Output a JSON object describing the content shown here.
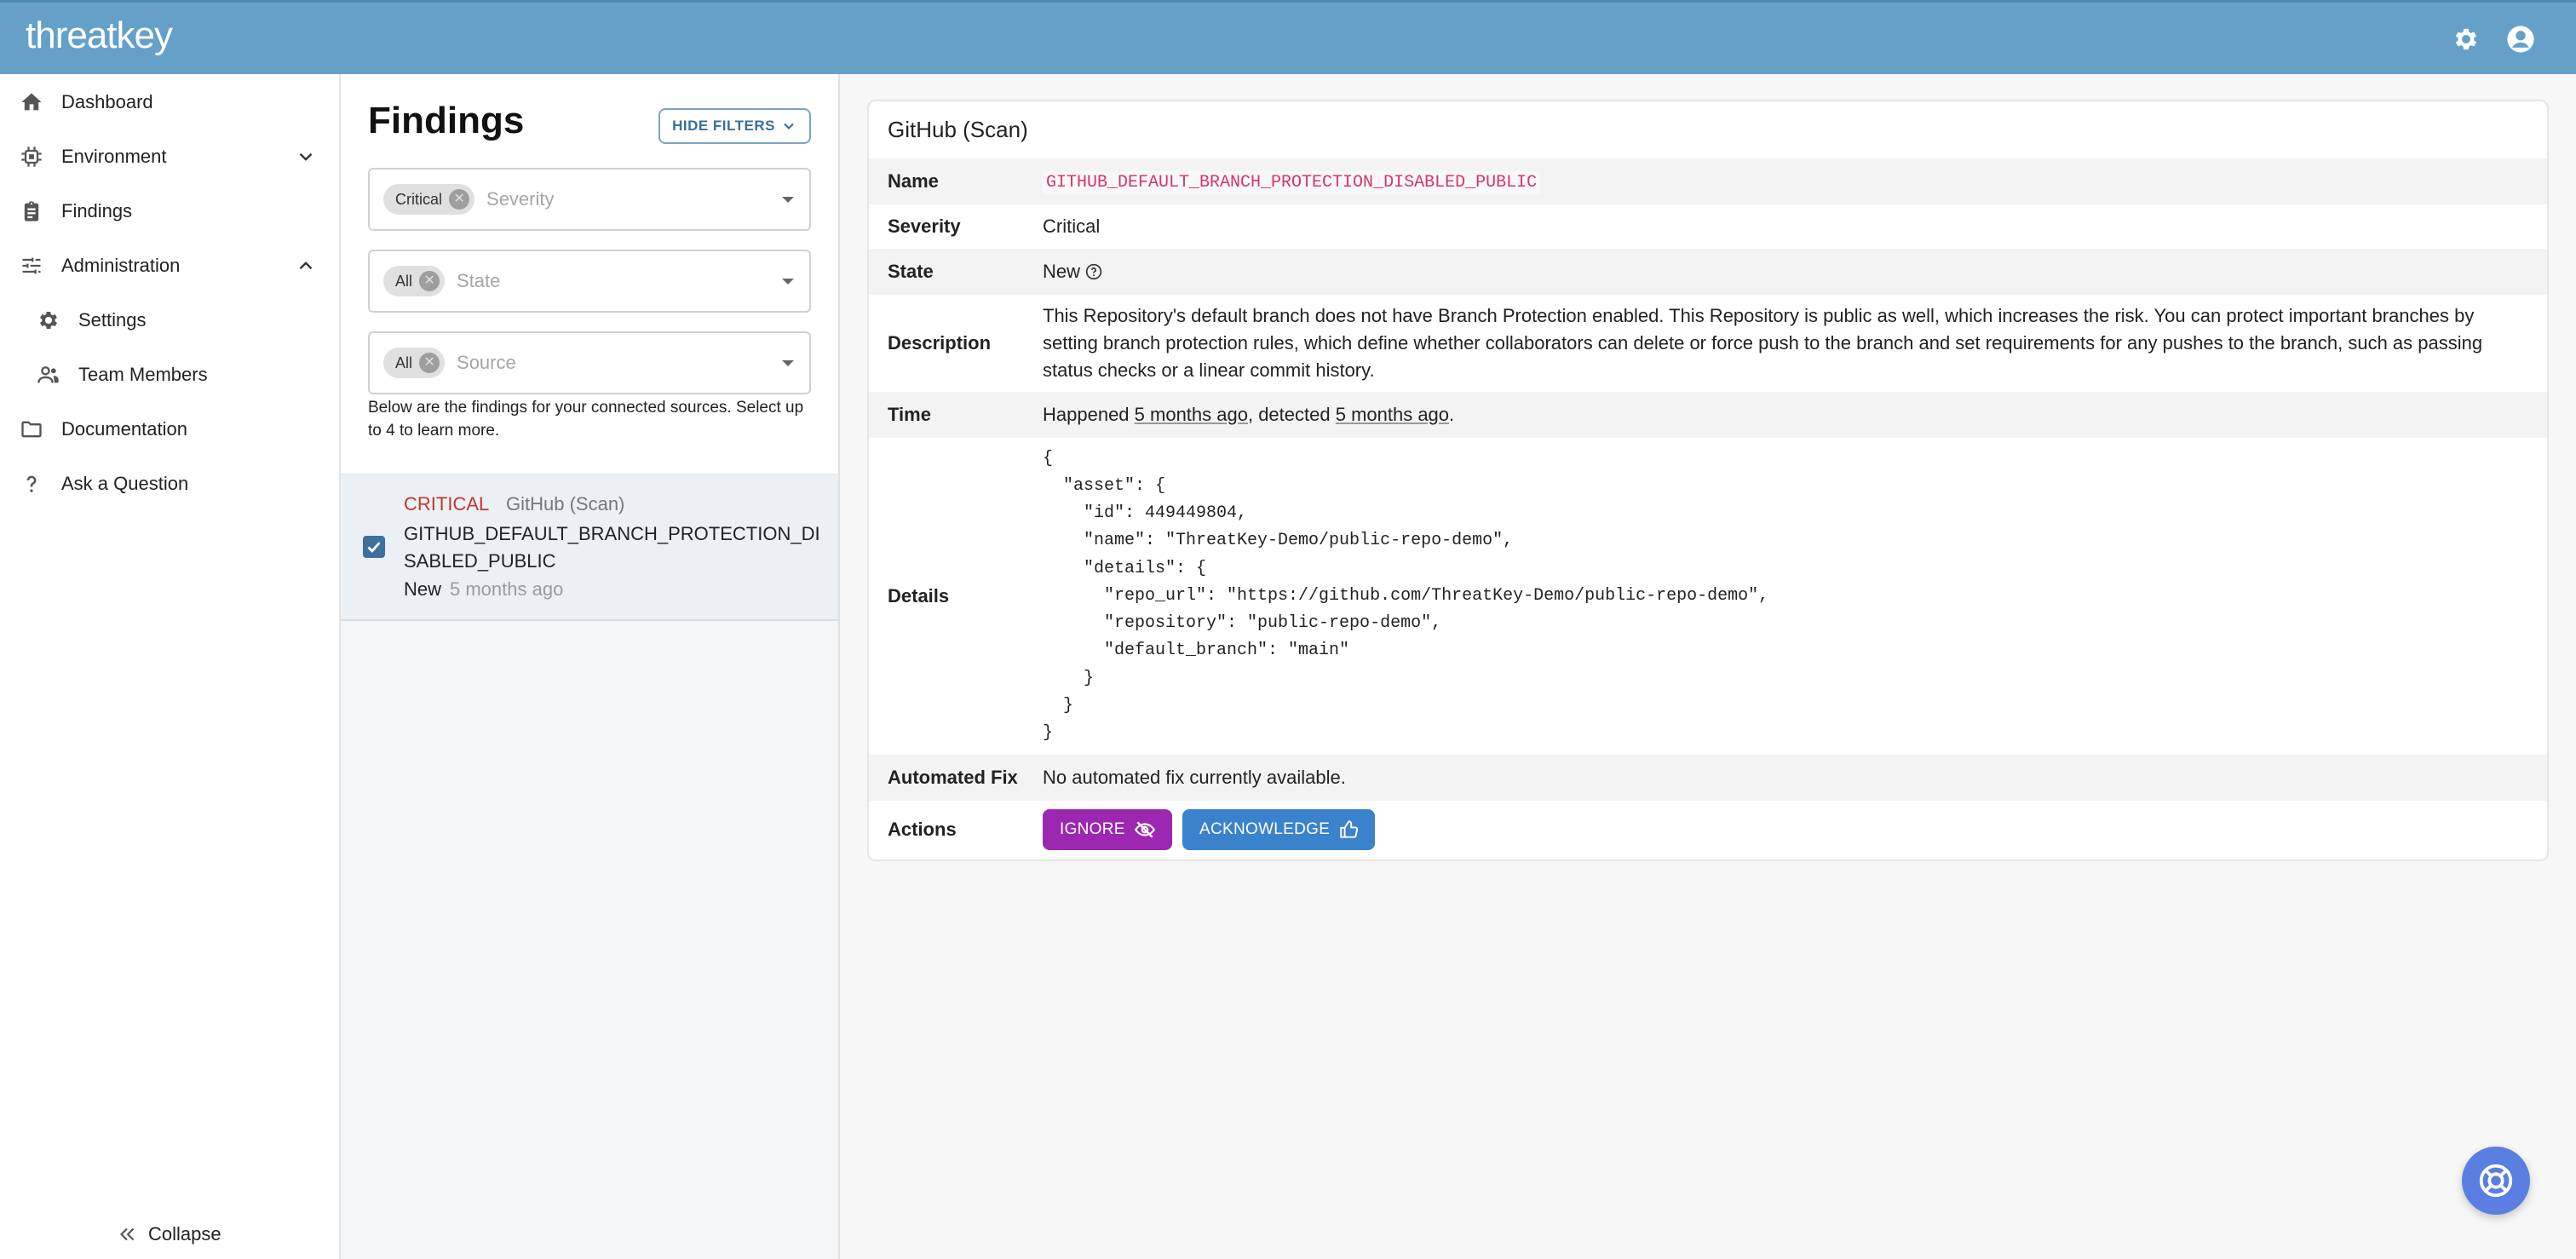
{
  "app": {
    "logo": "threatkey"
  },
  "sidebar": {
    "items": [
      {
        "label": "Dashboard"
      },
      {
        "label": "Environment"
      },
      {
        "label": "Findings"
      },
      {
        "label": "Administration"
      },
      {
        "label": "Settings"
      },
      {
        "label": "Team Members"
      },
      {
        "label": "Documentation"
      },
      {
        "label": "Ask a Question"
      }
    ],
    "collapse_label": "Collapse"
  },
  "findings": {
    "title": "Findings",
    "hide_filters_label": "HIDE FILTERS",
    "filters": [
      {
        "chip": "Critical",
        "placeholder": "Severity"
      },
      {
        "chip": "All",
        "placeholder": "State"
      },
      {
        "chip": "All",
        "placeholder": "Source"
      }
    ],
    "note": "Below are the findings for your connected sources. Select up to 4 to learn more.",
    "rows": [
      {
        "severity": "CRITICAL",
        "source": "GitHub (Scan)",
        "name": "GITHUB_DEFAULT_BRANCH_PROTECTION_DISABLED_PUBLIC",
        "state": "New",
        "time": "5 months ago",
        "checked": true
      }
    ]
  },
  "details": {
    "title": "GitHub (Scan)",
    "labels": {
      "name": "Name",
      "severity": "Severity",
      "state": "State",
      "description": "Description",
      "time": "Time",
      "details": "Details",
      "automated_fix": "Automated Fix",
      "actions": "Actions"
    },
    "name": "GITHUB_DEFAULT_BRANCH_PROTECTION_DISABLED_PUBLIC",
    "severity": "Critical",
    "state": "New",
    "description": "This Repository's default branch does not have Branch Protection enabled. This Repository is public as well, which increases the risk. You can protect important branches by setting branch protection rules, which define whether collaborators can delete or force push to the branch and set requirements for any pushes to the branch, such as passing status checks or a linear commit history.",
    "time": {
      "happened_prefix": "Happened ",
      "happened": "5 months ago",
      "detected_prefix": ", detected ",
      "detected": "5 months ago",
      "suffix": "."
    },
    "details_json": "{\n  \"asset\": {\n    \"id\": 449449804,\n    \"name\": \"ThreatKey-Demo/public-repo-demo\",\n    \"details\": {\n      \"repo_url\": \"https://github.com/ThreatKey-Demo/public-repo-demo\",\n      \"repository\": \"public-repo-demo\",\n      \"default_branch\": \"main\"\n    }\n  }\n}",
    "automated_fix": "No automated fix currently available.",
    "actions": {
      "ignore": "IGNORE",
      "acknowledge": "ACKNOWLEDGE"
    }
  },
  "colors": {
    "topbar": "#64a0c8",
    "critical": "#c0392b",
    "ignore": "#9c27b0",
    "acknowledge": "#3a82cc",
    "inline_code": "#d6336c"
  },
  "icons": {
    "topbar": [
      "gear-icon",
      "account-icon"
    ],
    "sidebar": [
      "home-icon",
      "chip-icon",
      "clipboard-icon",
      "sliders-icon",
      "gear-icon",
      "people-icon",
      "folder-icon",
      "question-icon"
    ],
    "actions": [
      "eye-off-icon",
      "thumbs-up-icon"
    ],
    "fab": "lifebuoy-icon"
  }
}
